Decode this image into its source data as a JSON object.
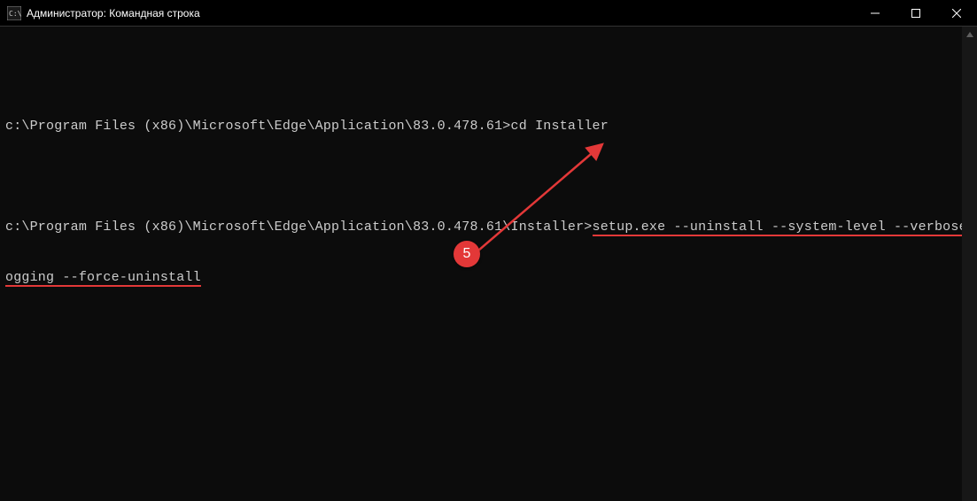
{
  "window": {
    "title": "Администратор: Командная строка"
  },
  "terminal": {
    "line1_prompt": "c:\\Program Files (x86)\\Microsoft\\Edge\\Application\\83.0.478.61>",
    "line1_cmd": "cd Installer",
    "line2_prompt": "c:\\Program Files (x86)\\Microsoft\\Edge\\Application\\83.0.478.61\\Installer>",
    "line2_cmd_part1": "setup.exe --uninstall --system-level --verbose-l",
    "line2_cmd_part2": "ogging --force-uninstall"
  },
  "annotation": {
    "number": "5"
  }
}
